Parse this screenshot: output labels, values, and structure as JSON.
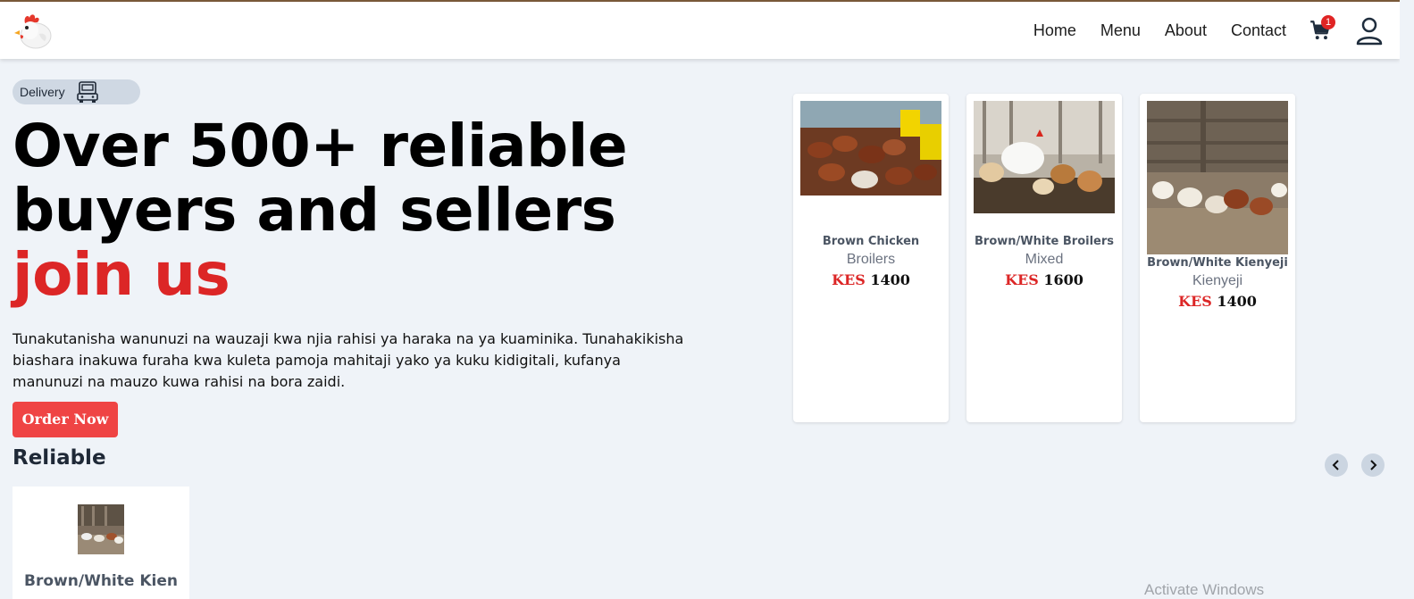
{
  "nav": {
    "links": [
      "Home",
      "Menu",
      "About",
      "Contact"
    ],
    "cart_count": "1"
  },
  "hero": {
    "badge_label": "Delivery",
    "title_line1": "Over 500+ reliable",
    "title_line2": "buyers and sellers",
    "title_line3": "join us",
    "description": "Tunakutanisha wanunuzi na wauzaji kwa njia rahisi ya haraka na ya kuaminika. Tunahakikisha biashara inakuwa furaha kwa kuleta pamoja mahitaji yako ya kuku kidigitali, kufanya manunuzi na mauzo kuwa rahisi na bora zaidi.",
    "cta_label": "Order Now"
  },
  "reliable": {
    "title": "Reliable",
    "items": [
      {
        "name": "Brown/White Kien"
      }
    ]
  },
  "products": [
    {
      "name": "Brown Chicken",
      "category": "Broilers",
      "currency": "KES",
      "price": "1400"
    },
    {
      "name": "Brown/White Broilers",
      "category": "Mixed",
      "currency": "KES",
      "price": "1600"
    },
    {
      "name": "Brown/White Kienyeji",
      "category": "Kienyeji",
      "currency": "KES",
      "price": "1400"
    }
  ],
  "watermark": "Activate Windows",
  "colors": {
    "accent": "#dc2626",
    "button": "#ef4444",
    "background": "#eff3f8"
  }
}
